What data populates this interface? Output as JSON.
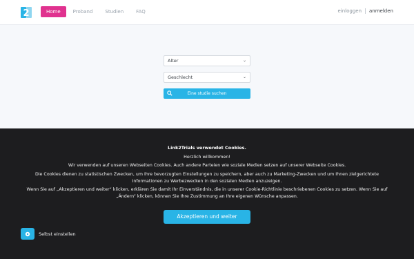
{
  "nav": {
    "links": [
      {
        "label": "Home",
        "active": true
      },
      {
        "label": "Proband",
        "active": false
      },
      {
        "label": "Studien",
        "active": false
      },
      {
        "label": "FAQ",
        "active": false
      }
    ],
    "login_label": "einloggen",
    "register_label": "anmelden",
    "logo_icon": "link2trials-logo",
    "accent_color": "#e0328f"
  },
  "search": {
    "age_select": "Alter",
    "gender_select": "Geschlecht",
    "button_label": "Eine studie suchen",
    "button_icon": "search-icon",
    "button_color": "#29b4e6"
  },
  "cookie": {
    "title": "Link2Trials verwendet Cookies.",
    "greeting": "Herzlich willkommen!",
    "line1": "Wir verwenden auf unseren Webseiten Cookies. Auch andere Parteien wie soziale Medien setzen auf unserer Webseite Cookies.",
    "line2": "Die Cookies dienen zu statistischen Zwecken, um Ihre bevorzugten Einstellungen zu speichern, aber auch zu Marketing-Zwecken und um Ihnen zielgerichtete Informationen zu Werbezwecken in den sozialen Medien anzuzeigen.",
    "line3": "Wenn Sie auf „Akzeptieren und weiter“ klicken, erklären Sie damit Ihr Einverständnis, die in unserer Cookie-Richtlinie beschriebenen Cookies zu setzen. Wenn Sie auf „Ändern“ klicken, können Sie Ihre Zustimmung an Ihre eigenen Wünsche anpassen.",
    "accept_label": "Akzeptieren und weiter",
    "self_settings_label": "Selbst einstellen",
    "settings_icon": "gear-icon",
    "background_color": "#1d1d1f"
  }
}
